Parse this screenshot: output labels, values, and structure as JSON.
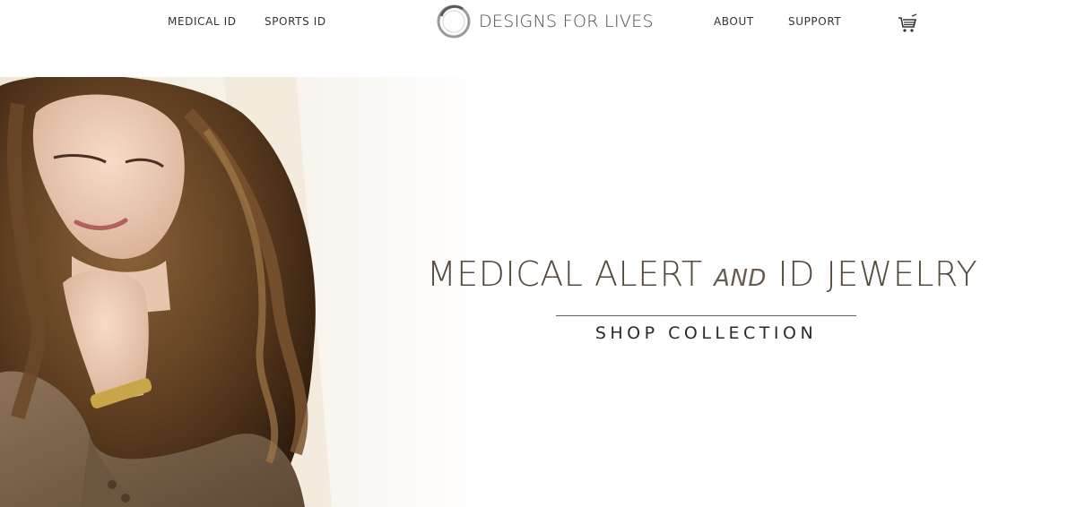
{
  "nav": {
    "medical_id": "MEDICAL ID",
    "sports_id": "SPORTS ID",
    "about": "ABOUT",
    "support": "SUPPORT"
  },
  "logo": {
    "text": "DESIGNS FOR LIVES"
  },
  "cart": {
    "icon": "cart-icon"
  },
  "hero": {
    "title_part1": "MEDICAL ALERT ",
    "title_and": "AND",
    "title_part2": " ID JEWELRY",
    "cta": "SHOP COLLECTION"
  },
  "colors": {
    "brand_text": "#55493c",
    "nav_text": "#333333",
    "rule": "#6a5d50"
  }
}
